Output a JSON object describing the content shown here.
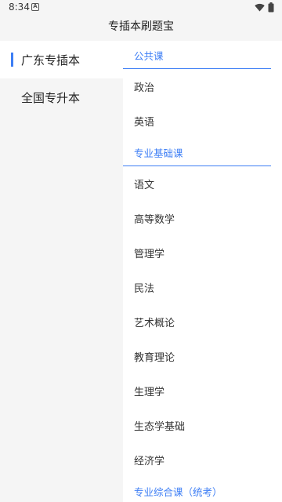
{
  "status_bar": {
    "time": "8:34",
    "notification_letter": "A"
  },
  "app_bar": {
    "title": "专插本刷题宝"
  },
  "sidebar": {
    "items": [
      {
        "label": "广东专插本",
        "active": true
      },
      {
        "label": "全国专升本",
        "active": false
      }
    ]
  },
  "content": {
    "sections": [
      {
        "header": "公共课",
        "items": [
          "政治",
          "英语"
        ]
      },
      {
        "header": "专业基础课",
        "items": [
          "语文",
          "高等数学",
          "管理学",
          "民法",
          "艺术概论",
          "教育理论",
          "生理学",
          "生态学基础",
          "经济学"
        ]
      },
      {
        "header": "专业综合课（统考）",
        "items": []
      }
    ]
  },
  "colors": {
    "accent": "#3d7ef5",
    "sidebar_bg": "#f5f5f5",
    "content_bg": "#ffffff"
  }
}
